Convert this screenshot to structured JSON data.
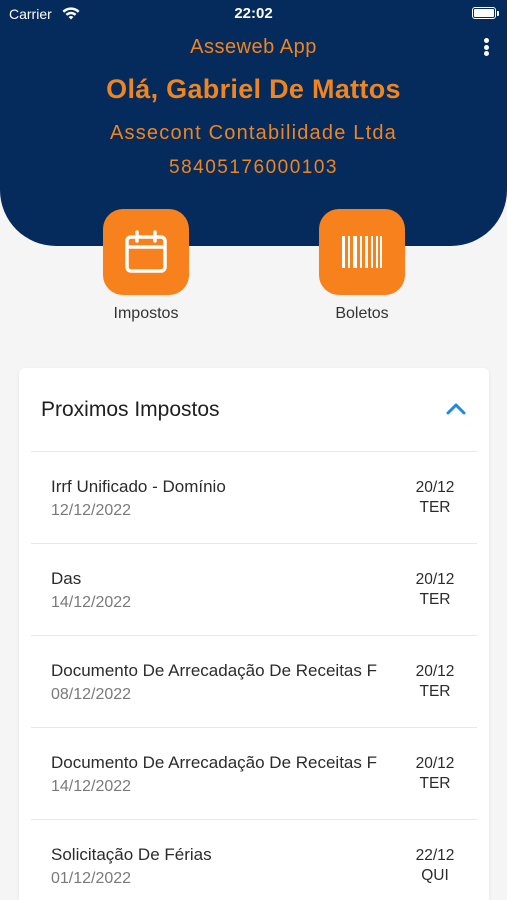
{
  "status_bar": {
    "carrier": "Carrier",
    "time": "22:02"
  },
  "header": {
    "app_title": "Asseweb App",
    "greeting": "Olá, Gabriel De Mattos",
    "company": "Assecont Contabilidade Ltda",
    "cnpj": "58405176000103",
    "menu_icon": "more-vertical-icon"
  },
  "quick_actions": [
    {
      "label": "Impostos",
      "icon": "calendar-icon"
    },
    {
      "label": "Boletos",
      "icon": "barcode-icon"
    }
  ],
  "colors": {
    "header_bg": "#052a5c",
    "accent": "#f7811d",
    "chevron": "#1e88e5"
  },
  "upcoming": {
    "title": "Proximos Impostos",
    "toggle_icon": "chevron-up-icon",
    "items": [
      {
        "name": "Irrf Unificado - Domínio",
        "date": "12/12/2022",
        "due_date": "20/12",
        "weekday": "TER"
      },
      {
        "name": "Das",
        "date": "14/12/2022",
        "due_date": "20/12",
        "weekday": "TER"
      },
      {
        "name": "Documento De Arrecadação De Receitas Fe",
        "date": "08/12/2022",
        "due_date": "20/12",
        "weekday": "TER"
      },
      {
        "name": "Documento De Arrecadação De Receitas Fe",
        "date": "14/12/2022",
        "due_date": "20/12",
        "weekday": "TER"
      },
      {
        "name": "Solicitação De Férias",
        "date": "01/12/2022",
        "due_date": "22/12",
        "weekday": "QUI"
      }
    ]
  }
}
